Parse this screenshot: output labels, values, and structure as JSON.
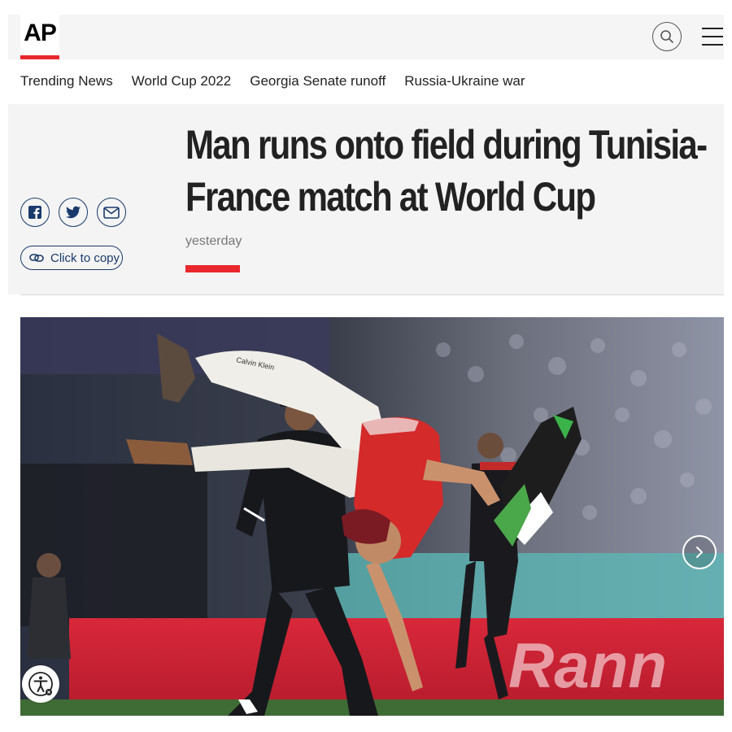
{
  "colors": {
    "accent_red": "#e8282d",
    "share_blue": "#1a3a6c",
    "header_bg": "#f5f5f5"
  },
  "header": {
    "logo_text": "AP",
    "search_icon": "search-icon",
    "menu_icon": "hamburger-menu-icon"
  },
  "nav": {
    "items": [
      {
        "label": "Trending News"
      },
      {
        "label": "World Cup 2022"
      },
      {
        "label": "Georgia Senate runoff"
      },
      {
        "label": "Russia-Ukraine war"
      }
    ]
  },
  "article": {
    "headline": "Man runs onto field during Tunisia-France match at World Cup",
    "timestamp": "yesterday",
    "share": {
      "icons": [
        "facebook-icon",
        "twitter-icon",
        "email-icon"
      ],
      "copy_label": "Click to copy"
    }
  },
  "photo": {
    "next_icon": "chevron-right-icon",
    "accessibility_icon": "accessibility-icon",
    "pants_text": "Calvin Klein",
    "board_text": "Rann"
  }
}
